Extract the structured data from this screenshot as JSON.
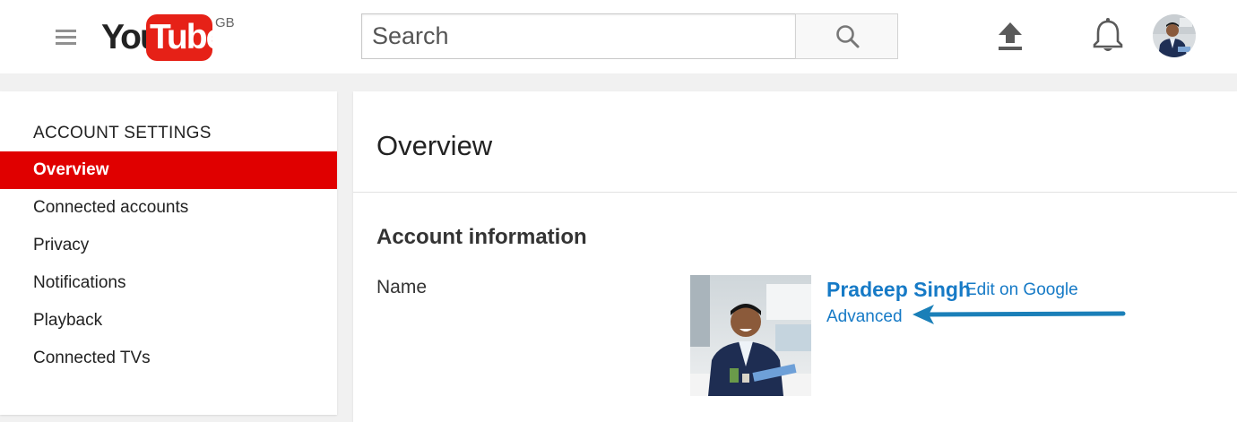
{
  "header": {
    "logo_you": "You",
    "logo_tube": "Tube",
    "logo_region": "GB",
    "search_placeholder": "Search",
    "icons": [
      "menu-icon",
      "search-icon",
      "upload-icon",
      "bell-icon",
      "avatar"
    ]
  },
  "sidebar": {
    "heading": "ACCOUNT SETTINGS",
    "items": [
      {
        "label": "Overview",
        "active": true
      },
      {
        "label": "Connected accounts"
      },
      {
        "label": "Privacy"
      },
      {
        "label": "Notifications"
      },
      {
        "label": "Playback"
      },
      {
        "label": "Connected TVs"
      }
    ]
  },
  "main": {
    "title": "Overview",
    "section_title": "Account information",
    "name_label": "Name",
    "profile_name": "Pradeep Singh",
    "edit_link": "Edit on Google",
    "advanced_link": "Advanced"
  },
  "colors": {
    "brand_red": "#e62117",
    "active_red": "#e00000",
    "link_blue": "#167ac6",
    "annotation_arrow": "#1a7fb8"
  }
}
